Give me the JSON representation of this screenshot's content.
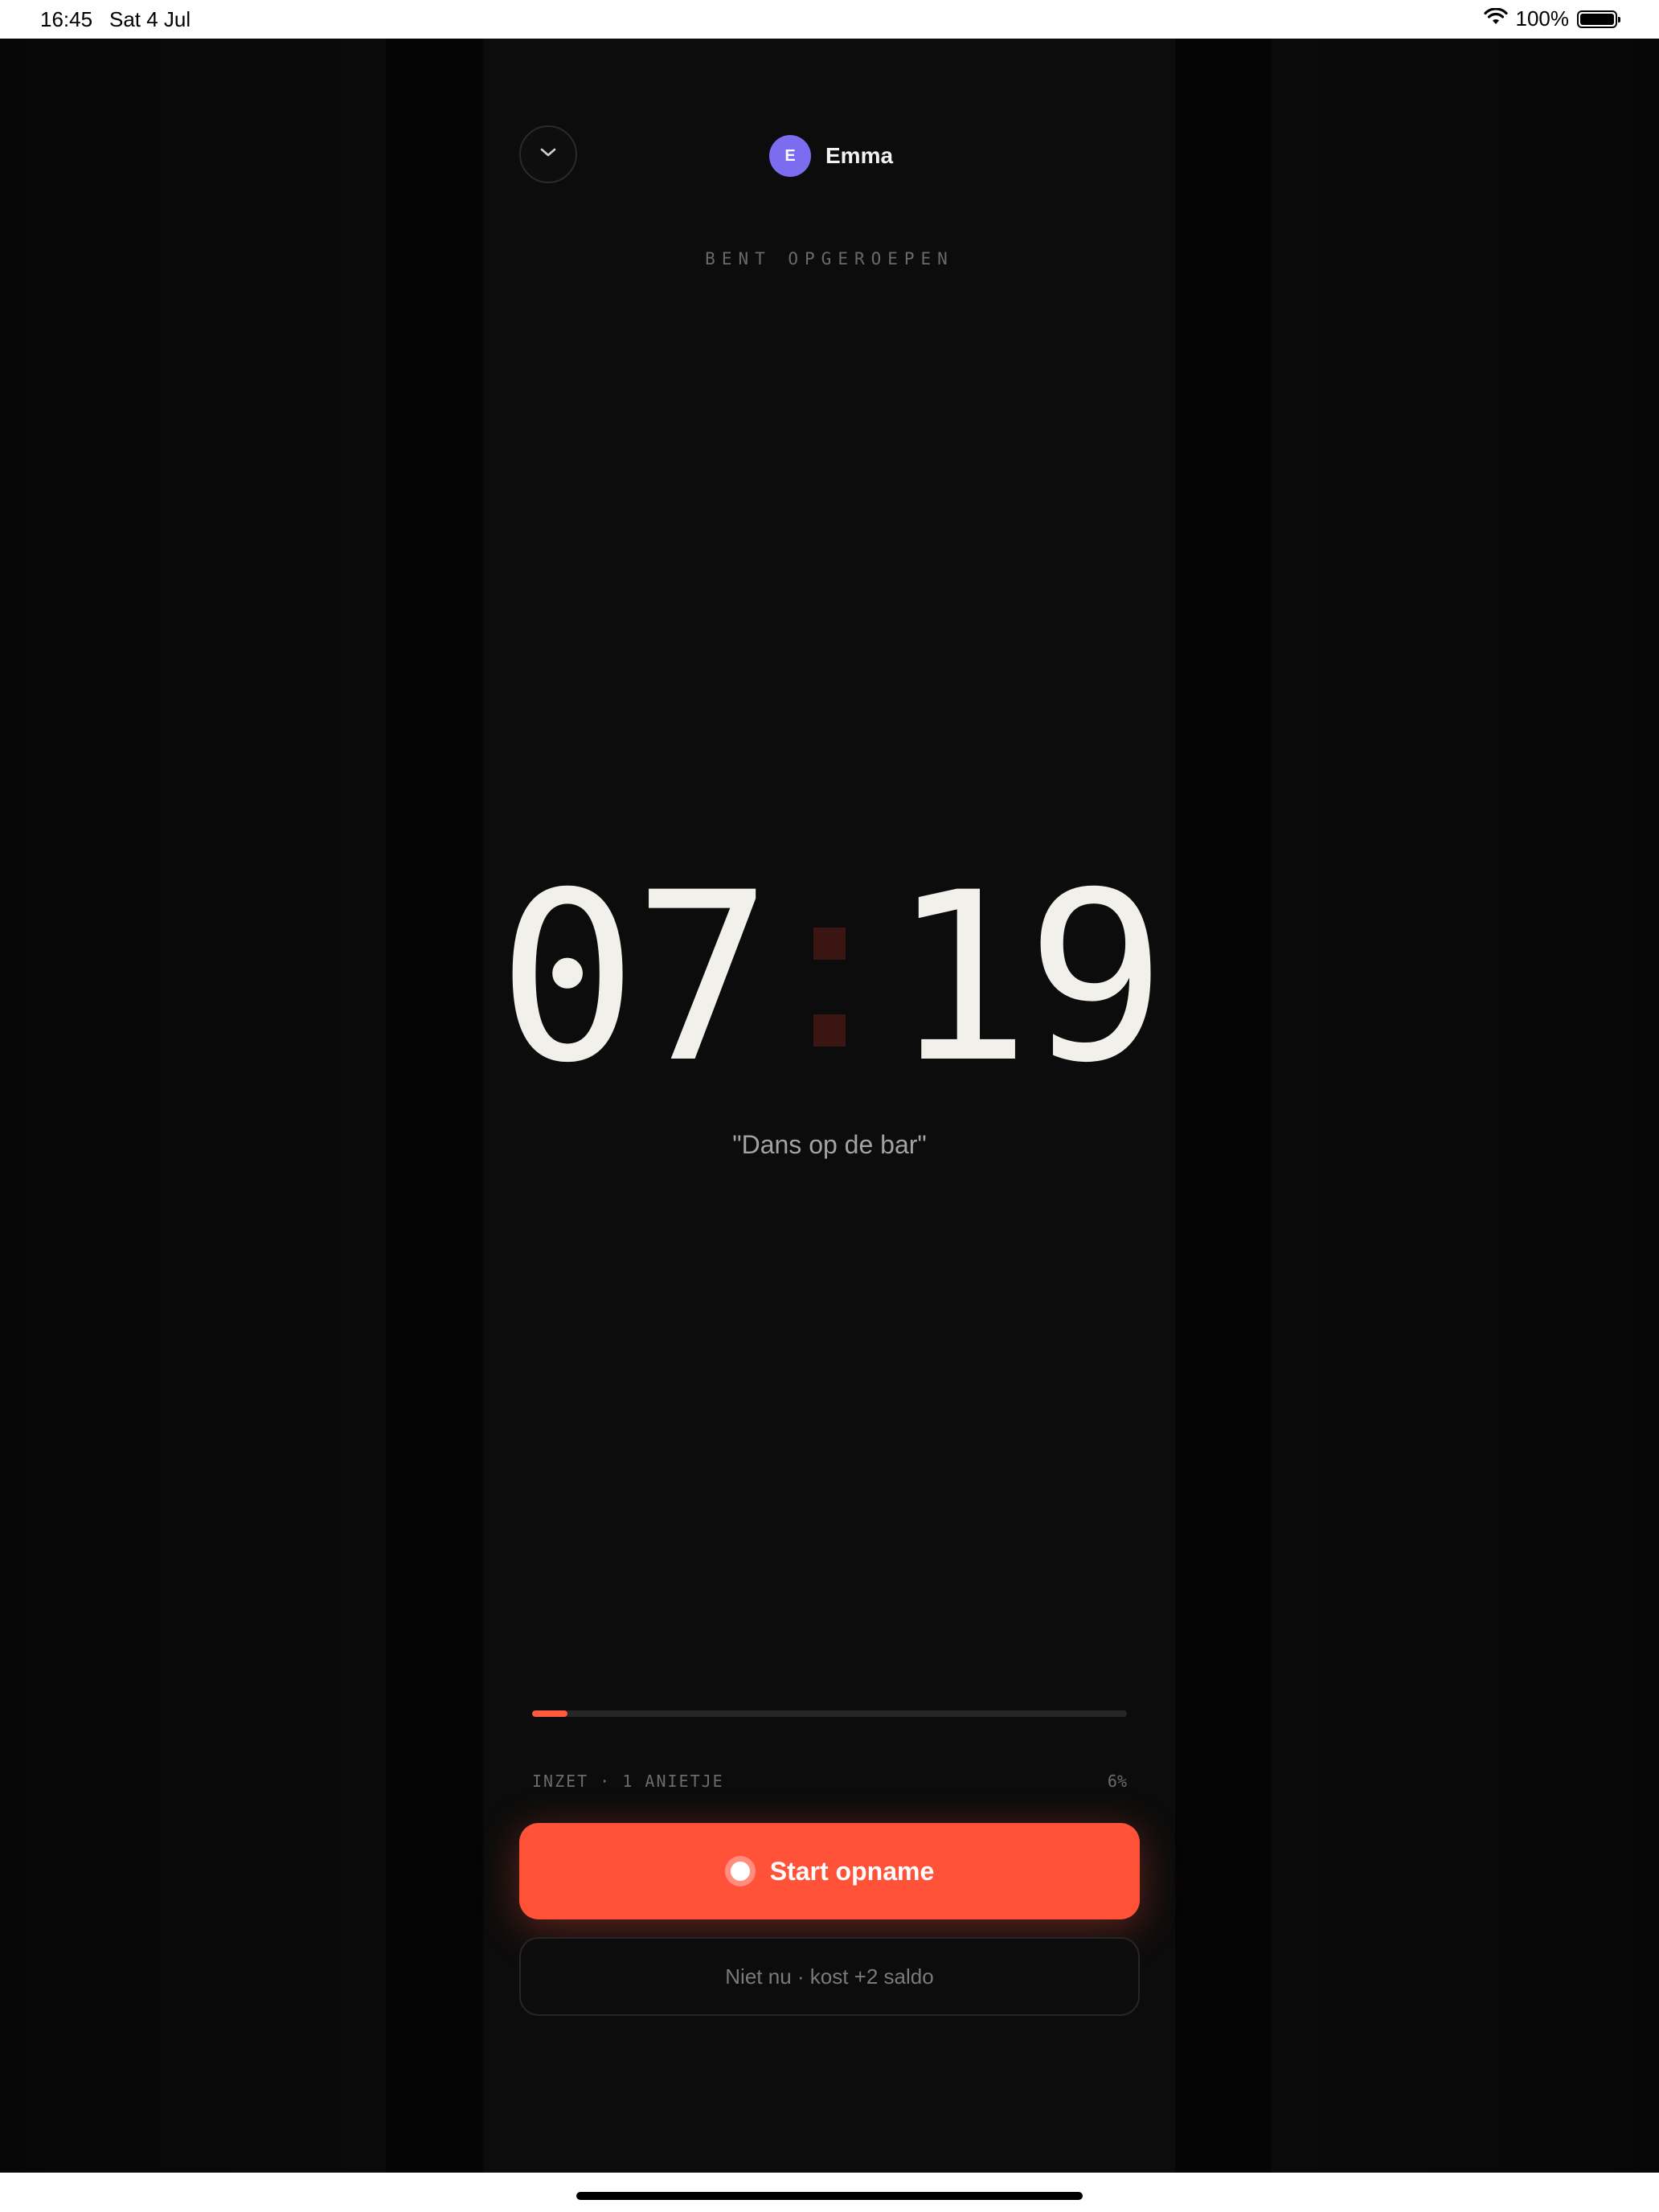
{
  "status_bar": {
    "time": "16:45",
    "date": "Sat 4 Jul",
    "battery": "100%"
  },
  "header": {
    "collapse_icon": "chevron-down-icon",
    "user": {
      "initial": "E",
      "name": "Emma",
      "avatar_color": "#7b6cf0"
    }
  },
  "status_label": "BENT OPGEROEPEN",
  "timer": {
    "minutes": "07",
    "seconds": "19"
  },
  "dare": "\"Dans op de bar\"",
  "progress": {
    "label": "INZET · 1 ANIETJE",
    "percent_text": "6%",
    "fraction": 0.06
  },
  "actions": {
    "start_label": "Start opname",
    "skip_label": "Niet nu · kost +2 saldo"
  },
  "colors": {
    "accent": "#ff5239",
    "background": "#0c0c0c",
    "timer_text": "#f1f0ea"
  }
}
